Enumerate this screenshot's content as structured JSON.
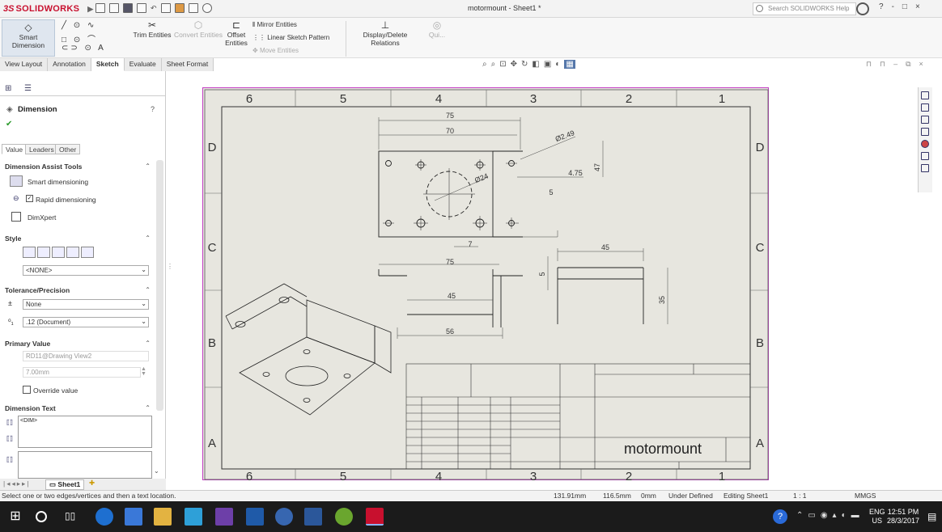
{
  "app": {
    "logo_ds": "3S",
    "logo_name": "SOLIDWORKS",
    "doc_title": "motormount - Sheet1 *",
    "search_placeholder": "Search SOLIDWORKS Help"
  },
  "window_controls": [
    "?",
    "-",
    "□",
    "×"
  ],
  "ribbon": {
    "smart_dimension": "Smart Dimension",
    "trim": "Trim Entities",
    "convert": "Convert Entities",
    "offset": "Offset Entities",
    "mirror": "Mirror Entities",
    "linear_pattern": "Linear Sketch Pattern",
    "move": "Move Entities",
    "relations": "Display/Delete Relations",
    "quick": "Qui..."
  },
  "cmd_tabs": [
    "View Layout",
    "Annotation",
    "Sketch",
    "Evaluate",
    "Sheet Format"
  ],
  "active_tab": "Sketch",
  "pane": {
    "title": "Dimension",
    "tabs": [
      "Value",
      "Leaders",
      "Other"
    ],
    "assist_header": "Dimension Assist Tools",
    "smart_dim": "Smart dimensioning",
    "rapid_dim": "Rapid dimensioning",
    "dimxpert": "DimXpert",
    "style_header": "Style",
    "style_value": "<NONE>",
    "tol_header": "Tolerance/Precision",
    "tol_value": "None",
    "precision_value": ".12 (Document)",
    "primary_header": "Primary Value",
    "primary_name": "RD11@Drawing View2",
    "primary_value": "7.00mm",
    "override": "Override value",
    "dimtext_header": "Dimension Text",
    "dimtext_value": "<DIM>"
  },
  "sheet_tab": "Sheet1",
  "status": {
    "hint": "Select one or two edges/vertices and then a text location.",
    "x": "131.91mm",
    "y": "116.5mm",
    "z": "0mm",
    "state": "Under Defined",
    "editing": "Editing Sheet1",
    "scale": "1 : 1",
    "units": "MMGS"
  },
  "drawing": {
    "zone_cols_top": [
      "6",
      "5",
      "4",
      "3",
      "2",
      "1"
    ],
    "zone_cols_bottom": [
      "6",
      "5",
      "4",
      "3",
      "2",
      "1"
    ],
    "zone_rows_left": [
      "D",
      "C",
      "B",
      "A"
    ],
    "zone_rows_right": [
      "D",
      "C",
      "B",
      "A"
    ],
    "title": "motormount",
    "dims": {
      "top_75": "75",
      "top_70": "70",
      "dia_249": "Ø2.49",
      "dia_24": "Ø24",
      "d_475": "4.75",
      "d_5": "5",
      "d_47": "47",
      "d_7": "7",
      "side_75": "75",
      "side_45": "45",
      "side_56": "56",
      "right_45": "45",
      "right_35": "35",
      "right_5": "5"
    }
  },
  "taskbar": {
    "lang": "ENG",
    "region": "US",
    "time": "12:51 PM",
    "date": "28/3/2017"
  }
}
